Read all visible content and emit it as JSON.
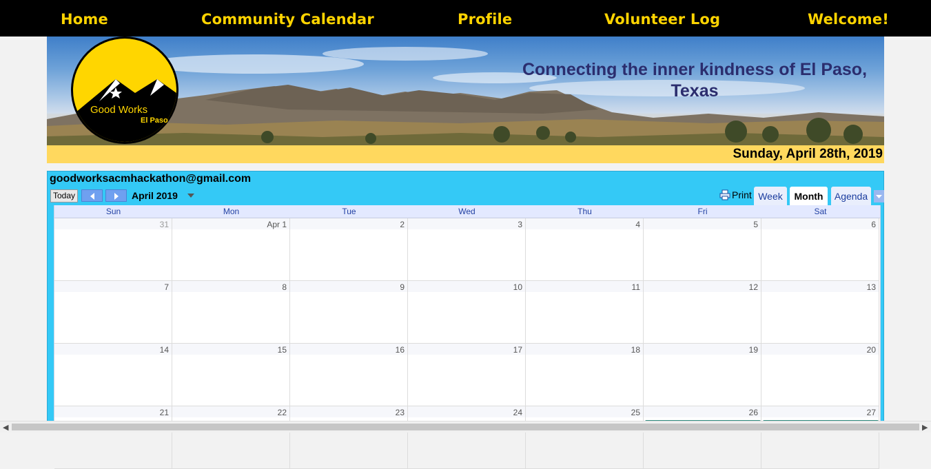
{
  "nav": {
    "home": "Home",
    "calendar": "Community Calendar",
    "profile": "Profile",
    "volunteer_log": "Volunteer Log",
    "welcome": "Welcome!"
  },
  "banner": {
    "logo_line1": "Good Works",
    "logo_line2": "El Paso",
    "tagline_line1": "Connecting the inner kindness of El Paso,",
    "tagline_line2": "Texas",
    "date": "Sunday, April 28th, 2019"
  },
  "calendar": {
    "account": "goodworksacmhackathon@gmail.com",
    "today_label": "Today",
    "month_label": "April 2019",
    "print_label": "Print",
    "tabs": [
      {
        "label": "Week",
        "active": false
      },
      {
        "label": "Month",
        "active": true
      },
      {
        "label": "Agenda",
        "active": false
      }
    ],
    "days_of_week": [
      "Sun",
      "Mon",
      "Tue",
      "Wed",
      "Thu",
      "Fri",
      "Sat"
    ],
    "weeks": [
      [
        "31",
        "Apr 1",
        "2",
        "3",
        "4",
        "5",
        "6"
      ],
      [
        "7",
        "8",
        "9",
        "10",
        "11",
        "12",
        "13"
      ],
      [
        "14",
        "15",
        "16",
        "17",
        "18",
        "19",
        "20"
      ],
      [
        "21",
        "22",
        "23",
        "24",
        "25",
        "26",
        "27"
      ]
    ],
    "colors": {
      "header_bg": "#34c9f6",
      "event": "#41a89a",
      "nav_text": "#ffd400",
      "date_bar": "#ffd85e"
    }
  }
}
